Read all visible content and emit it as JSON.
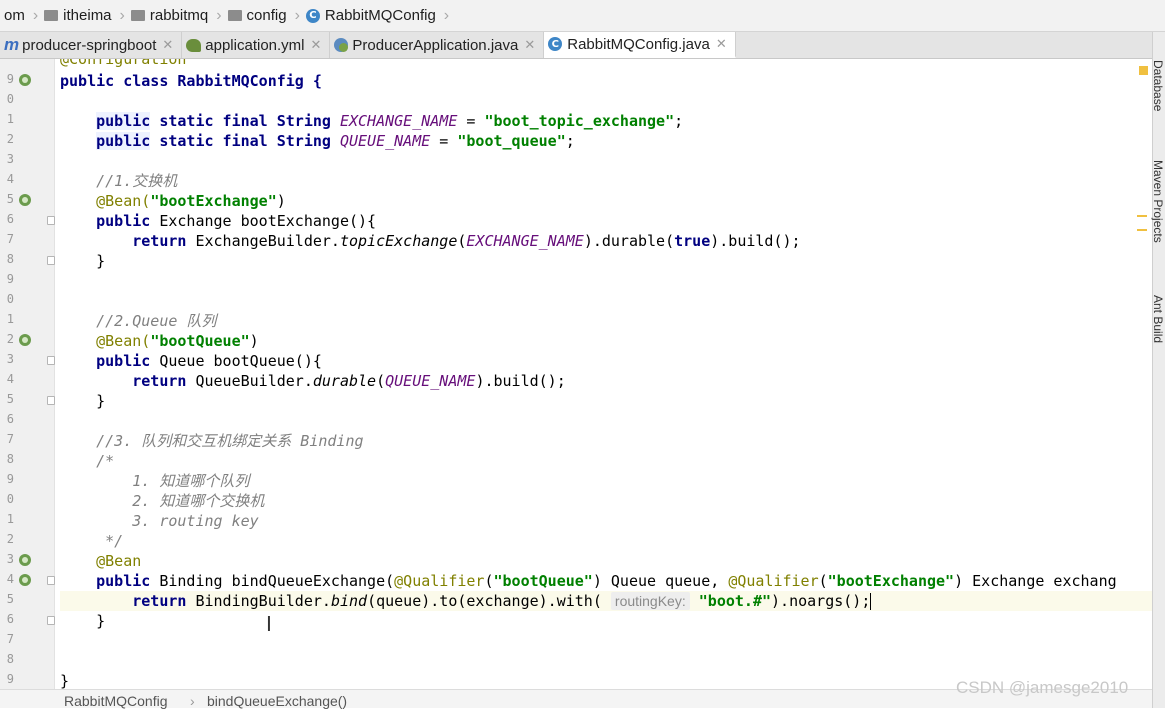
{
  "breadcrumb": {
    "items": [
      "om",
      "itheima",
      "rabbitmq",
      "config",
      "RabbitMQConfig"
    ]
  },
  "tabs": [
    {
      "label": "producer-springboot",
      "icon": "maven-module-icon"
    },
    {
      "label": "application.yml",
      "icon": "yaml-file-icon"
    },
    {
      "label": "ProducerApplication.java",
      "icon": "spring-app-icon"
    },
    {
      "label": "RabbitMQConfig.java",
      "icon": "java-class-icon",
      "active": true
    }
  ],
  "gutter": {
    "line_numbers": [
      "9",
      "0",
      "1",
      "2",
      "3",
      "4",
      "5",
      "6",
      "7",
      "8",
      "9",
      "0",
      "1",
      "2",
      "3",
      "4",
      "5",
      "6",
      "7",
      "8",
      "9",
      "0",
      "1",
      "2",
      "3",
      "4",
      "5",
      "6",
      "7",
      "8",
      "9"
    ]
  },
  "code": {
    "l00": "@Configuration",
    "l01": "public class RabbitMQConfig {",
    "l03_kw1": "public",
    "l03_rest": " static final String ",
    "l03_const": "EXCHANGE_NAME",
    "l03_eq": " = ",
    "l03_str": "\"boot_topic_exchange\"",
    "l03_end": ";",
    "l04_kw1": "public",
    "l04_rest": " static final String ",
    "l04_const": "QUEUE_NAME",
    "l04_eq": " = ",
    "l04_str": "\"boot_queue\"",
    "l04_end": ";",
    "l06": "//1.交换机",
    "l07_ann": "@Bean(",
    "l07_str": "\"bootExchange\"",
    "l07_end": ")",
    "l08_kw": "public",
    "l08_rest": " Exchange bootExchange(){",
    "l09_kw": "return",
    "l09_a": " ExchangeBuilder.",
    "l09_it": "topicExchange",
    "l09_b": "(",
    "l09_const": "EXCHANGE_NAME",
    "l09_c": ").durable(",
    "l09_true": "true",
    "l09_d": ").build();",
    "l10": "}",
    "l13": "//2.Queue 队列",
    "l14_ann": "@Bean(",
    "l14_str": "\"bootQueue\"",
    "l14_end": ")",
    "l15_kw": "public",
    "l15_rest": " Queue bootQueue(){",
    "l16_kw": "return",
    "l16_a": " QueueBuilder.",
    "l16_it": "durable",
    "l16_b": "(",
    "l16_const": "QUEUE_NAME",
    "l16_c": ").build();",
    "l17": "}",
    "l19": "//3. 队列和交互机绑定关系 Binding",
    "l20": "/*",
    "l21": "1. 知道哪个队列",
    "l22": "2. 知道哪个交换机",
    "l23": "3. routing key",
    "l24": "*/",
    "l25": "@Bean",
    "l26_kw": "public",
    "l26_a": " Binding bindQueueExchange(",
    "l26_ann1": "@Qualifier",
    "l26_b": "(",
    "l26_str1": "\"bootQueue\"",
    "l26_c": ") Queue queue, ",
    "l26_ann2": "@Qualifier",
    "l26_d": "(",
    "l26_str2": "\"bootExchange\"",
    "l26_e": ") Exchange exchang",
    "l27_kw": "return",
    "l27_a": " BindingBuilder.",
    "l27_it": "bind",
    "l27_b": "(queue).to(exchange).with( ",
    "l27_hint": "routingKey:",
    "l27_str": " \"boot.#\"",
    "l27_c": ").noargs();",
    "l28": "}",
    "l31": "}"
  },
  "right_tool_windows": [
    "Database",
    "Maven Projects",
    "Ant Build"
  ],
  "status": {
    "class_crumb": "RabbitMQConfig",
    "method_crumb": "bindQueueExchange()"
  },
  "watermark": "CSDN @jamesge2010"
}
